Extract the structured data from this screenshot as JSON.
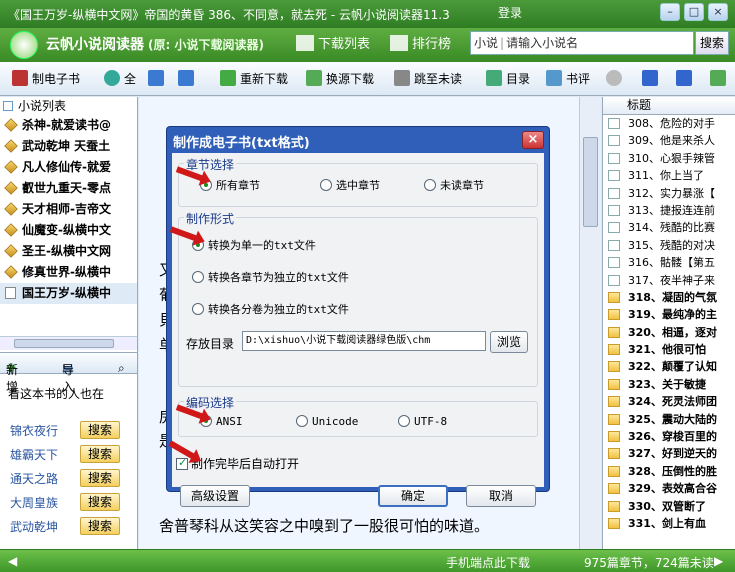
{
  "window": {
    "title": "《国王万岁-纵横中文网》帝国的黄昏 386、不同意，就去死 - 云帆小说阅读器11.3",
    "login": "登录",
    "min_glyph": "–",
    "max_glyph": "□",
    "close_glyph": "×"
  },
  "app": {
    "name": "云帆小说阅读器",
    "subtitle": "(原: 小说下载阅读器)",
    "nav": {
      "download_list": "下载列表",
      "ranking": "排行榜"
    },
    "search": {
      "category": "小说",
      "separator": "|",
      "placeholder": "请输入小说名",
      "button": "搜索"
    }
  },
  "toolbar": {
    "make_ebook": "制电子书",
    "all": "全",
    "redownload": "重新下载",
    "switch_source": "换源下载",
    "jump_unread": "跳至未读",
    "toc": "目录",
    "review": "书评"
  },
  "left": {
    "title": "小说列表",
    "books": [
      "杀神-就爱读书@",
      "武动乾坤 天蚕土",
      "凡人修仙传-就爱",
      "叡世九重天-零点",
      "天才相师-吉帝文",
      "仙魔变-纵横中文",
      "圣王-纵横中文网",
      "修真世界-纵横中",
      "国王万岁-纵横中"
    ],
    "add": "新增",
    "import": "导入",
    "also_reading": "看这本书的人也在",
    "recommendations": [
      {
        "name": "锦衣夜行",
        "button": "搜索"
      },
      {
        "name": "雄霸天下",
        "button": "搜索"
      },
      {
        "name": "通天之路",
        "button": "搜索"
      },
      {
        "name": "大周皇族",
        "button": "搜索"
      },
      {
        "name": "武动乾坤",
        "button": "搜索"
      }
    ]
  },
  "content": {
    "lines": [
      "又",
      "葡",
      "貝",
      "单",
      "房",
      "是"
    ],
    "bottom_line": "舍普琴科从这笑容之中嗅到了一股很可怕的味道。"
  },
  "right": {
    "header": "标题",
    "chapters": [
      {
        "title": "308、危险的对手",
        "unread": false
      },
      {
        "title": "309、他是来杀人",
        "unread": false
      },
      {
        "title": "310、心狠手辣管",
        "unread": false
      },
      {
        "title": "311、你上当了",
        "unread": false
      },
      {
        "title": "312、实力暴涨【",
        "unread": false
      },
      {
        "title": "313、捷报连连前",
        "unread": false
      },
      {
        "title": "314、残酷的比赛",
        "unread": false
      },
      {
        "title": "315、残酷的对决",
        "unread": false
      },
      {
        "title": "316、骷髅【第五",
        "unread": false
      },
      {
        "title": "317、夜半神子来",
        "unread": false
      },
      {
        "title": "318、凝固的气氛",
        "unread": true
      },
      {
        "title": "319、最纯净的主",
        "unread": true
      },
      {
        "title": "320、相逼，逐对",
        "unread": true
      },
      {
        "title": "321、他很可怕",
        "unread": true
      },
      {
        "title": "322、颠覆了认知",
        "unread": true
      },
      {
        "title": "323、关于敏捷",
        "unread": true
      },
      {
        "title": "324、死灵法师团",
        "unread": true
      },
      {
        "title": "325、震动大陆的",
        "unread": true
      },
      {
        "title": "326、穿梭百里的",
        "unread": true
      },
      {
        "title": "327、好到逆天的",
        "unread": true
      },
      {
        "title": "328、压倒性的胜",
        "unread": true
      },
      {
        "title": "329、表效高合谷",
        "unread": true
      },
      {
        "title": "330、双管断了",
        "unread": true
      },
      {
        "title": "331、剑上有血",
        "unread": true
      }
    ]
  },
  "status": {
    "mobile": "手机端点此下载",
    "counts": "975篇章节，724篇未读"
  },
  "dialog": {
    "title": "制作成电子书(txt格式)",
    "close": "×",
    "chapter_group": "章节选择",
    "chapter_options": [
      "所有章节",
      "选中章节",
      "未读章节"
    ],
    "format_group": "制作形式",
    "format_options": [
      "转换为单一的txt文件",
      "转换各章节为独立的txt文件",
      "转换各分卷为独立的txt文件"
    ],
    "dir_label": "存放目录",
    "dir_value": "D:\\xishuo\\小说下载阅读器绿色版\\chm",
    "browse": "浏览",
    "encoding_group": "编码选择",
    "encoding_options": [
      "ANSI",
      "Unicode",
      "UTF-8"
    ],
    "auto_open": "制作完毕后自动打开",
    "advanced": "高级设置",
    "ok": "确定",
    "cancel": "取消"
  }
}
